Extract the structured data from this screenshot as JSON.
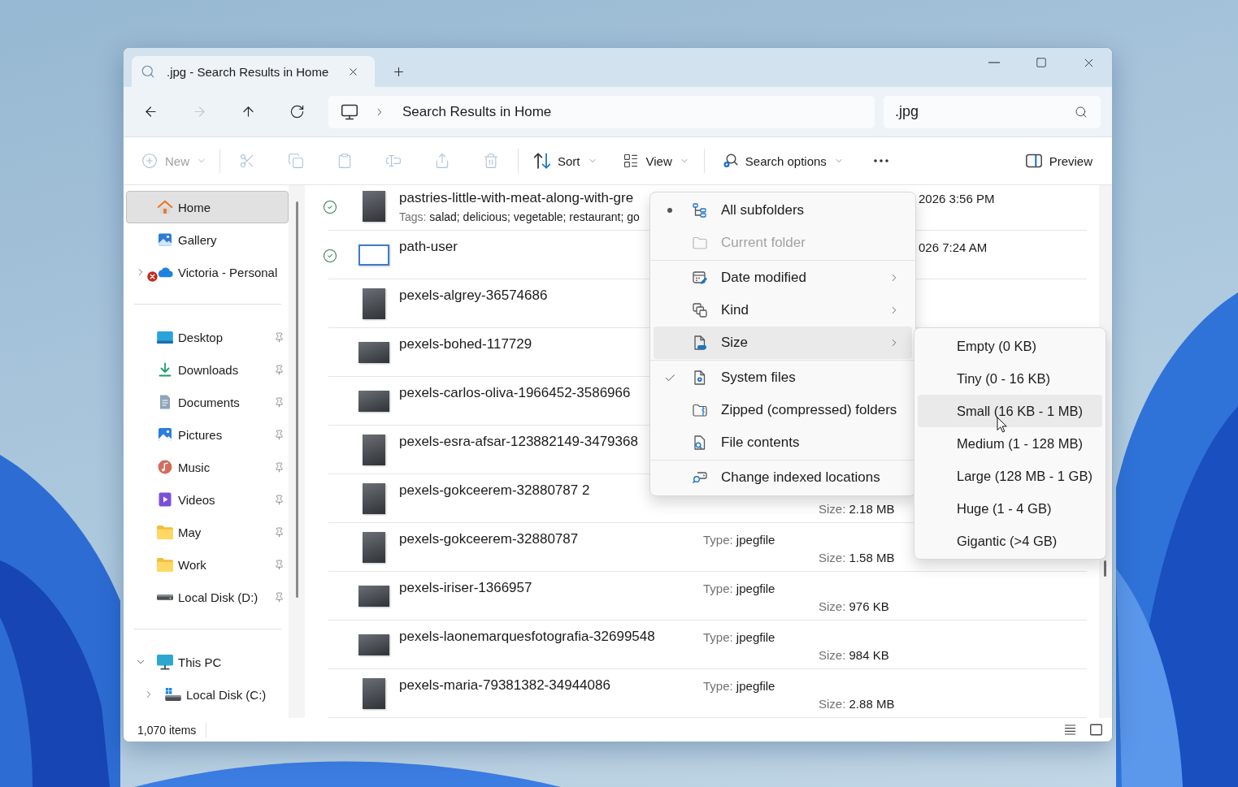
{
  "tabs": [
    {
      "title": ".jpg - Search Results in Home",
      "selected": true
    }
  ],
  "navigation": {
    "buttons": [
      {
        "disabled": false
      },
      {
        "disabled": true
      },
      {
        "disabled": false
      },
      {
        "disabled": false
      }
    ],
    "breadcrumbs": [
      "Search Results in Home"
    ],
    "search": {
      "value": ".jpg"
    }
  },
  "toolbar": {
    "new_button": {
      "label": "New",
      "disabled": true
    },
    "edit_buttons": [
      {
        "disabled": true
      },
      {
        "disabled": true
      },
      {
        "disabled": true
      },
      {
        "disabled": true
      },
      {
        "disabled": true
      },
      {
        "disabled": true
      }
    ],
    "sort_button": {
      "label": "Sort"
    },
    "view_button": {
      "label": "View"
    },
    "search_options_button": {
      "label": "Search options"
    },
    "preview_button": {
      "label": "Preview"
    }
  },
  "sidebar": {
    "sections": [
      {
        "items": [
          {
            "label": "Home",
            "kind": "home",
            "selected": true,
            "pinned": false
          },
          {
            "label": "Gallery",
            "kind": "gallery",
            "selected": false,
            "pinned": false
          },
          {
            "label": "Victoria - Personal",
            "kind": "cloud",
            "selected": false,
            "pinned": false,
            "expanded": false,
            "error": true
          }
        ]
      },
      {
        "items": [
          {
            "label": "Desktop",
            "kind": "desktop",
            "selected": false,
            "pinned": true
          },
          {
            "label": "Downloads",
            "kind": "downloads",
            "selected": false,
            "pinned": true
          },
          {
            "label": "Documents",
            "kind": "documents",
            "selected": false,
            "pinned": true
          },
          {
            "label": "Pictures",
            "kind": "pictures",
            "selected": false,
            "pinned": true
          },
          {
            "label": "Music",
            "kind": "music",
            "selected": false,
            "pinned": true
          },
          {
            "label": "Videos",
            "kind": "videos",
            "selected": false,
            "pinned": true
          },
          {
            "label": "May",
            "kind": "folder",
            "selected": false,
            "pinned": true
          },
          {
            "label": "Work",
            "kind": "folder",
            "selected": false,
            "pinned": true
          },
          {
            "label": "Local Disk (D:)",
            "kind": "drive",
            "selected": false,
            "pinned": true
          }
        ]
      },
      {
        "items": [
          {
            "label": "This PC",
            "kind": "pc",
            "selected": false,
            "pinned": false,
            "expanded": true,
            "children": [
              {
                "label": "Local Disk (C:)",
                "kind": "system_drive",
                "selected": false,
                "pinned": false,
                "expanded": false
              }
            ]
          }
        ]
      }
    ]
  },
  "files": [
    {
      "name": "pastries-little-with-meat-along-with-gre",
      "kind": "portrait",
      "synced": true,
      "tags_label": "Tags:",
      "tags": "salad; delicious; vegetable; restaurant; go",
      "date": "2026 3:56 PM"
    },
    {
      "name": "path-user",
      "kind": "screenshot",
      "synced": true,
      "date": "026 7:24 AM"
    },
    {
      "name": "pexels-algrey-36574686",
      "kind": "portrait",
      "synced": false
    },
    {
      "name": "pexels-bohed-117729",
      "kind": "landscape",
      "synced": false
    },
    {
      "name": "pexels-carlos-oliva-1966452-3586966",
      "kind": "landscape",
      "synced": false
    },
    {
      "name": "pexels-esra-afsar-123882149-3479368",
      "kind": "portrait",
      "synced": false
    },
    {
      "name": "pexels-gokceerem-32880787 2",
      "kind": "portrait",
      "synced": false,
      "size_label": "Size:",
      "size": "2.18 MB"
    },
    {
      "name": "pexels-gokceerem-32880787",
      "kind": "portrait",
      "synced": false,
      "type_label": "Type:",
      "type": "jpegfile",
      "size_label": "Size:",
      "size": "1.58 MB"
    },
    {
      "name": "pexels-iriser-1366957",
      "kind": "landscape",
      "synced": false,
      "type_label": "Type:",
      "type": "jpegfile",
      "size_label": "Size:",
      "size": "976 KB"
    },
    {
      "name": "pexels-laonemarquesfotografia-32699548",
      "kind": "landscape",
      "synced": false,
      "type_label": "Type:",
      "type": "jpegfile",
      "size_label": "Size:",
      "size": "984 KB"
    },
    {
      "name": "pexels-maria-79381382-34944086",
      "kind": "portrait",
      "synced": false,
      "type_label": "Type:",
      "type": "jpegfile",
      "size_label": "Size:",
      "size": "2.88 MB"
    }
  ],
  "status_bar": {
    "item_count": "1,070 items"
  },
  "search_options_menu": {
    "sections": [
      {
        "items": [
          {
            "kind": "radio",
            "label": "All subfolders",
            "selected": true,
            "disabled": false,
            "hovered": false
          },
          {
            "kind": "radio",
            "label": "Current folder",
            "selected": false,
            "disabled": true,
            "hovered": false
          }
        ]
      },
      {
        "items": [
          {
            "kind": "submenu",
            "label": "Date modified",
            "disabled": false,
            "hovered": false
          },
          {
            "kind": "submenu",
            "label": "Kind",
            "disabled": false,
            "hovered": false
          },
          {
            "kind": "submenu",
            "label": "Size",
            "disabled": false,
            "hovered": true
          }
        ]
      },
      {
        "items": [
          {
            "kind": "check",
            "label": "System files",
            "checked": true,
            "disabled": false,
            "hovered": false
          },
          {
            "kind": "check",
            "label": "Zipped (compressed) folders",
            "checked": false,
            "disabled": false,
            "hovered": false
          },
          {
            "kind": "check",
            "label": "File contents",
            "checked": false,
            "disabled": false,
            "hovered": false
          }
        ]
      },
      {
        "items": [
          {
            "kind": "action",
            "label": "Change indexed locations",
            "disabled": false,
            "hovered": false
          }
        ]
      }
    ]
  },
  "size_submenu": {
    "items": [
      {
        "label": "Empty (0 KB)",
        "hovered": false
      },
      {
        "label": "Tiny (0 - 16 KB)",
        "hovered": false
      },
      {
        "label": "Small (16 KB - 1 MB)",
        "hovered": true
      },
      {
        "label": "Medium (1 - 128 MB)",
        "hovered": false
      },
      {
        "label": "Large (128 MB - 1 GB)",
        "hovered": false
      },
      {
        "label": "Huge (1 - 4 GB)",
        "hovered": false
      },
      {
        "label": "Gigantic (>4 GB)",
        "hovered": false
      }
    ]
  }
}
